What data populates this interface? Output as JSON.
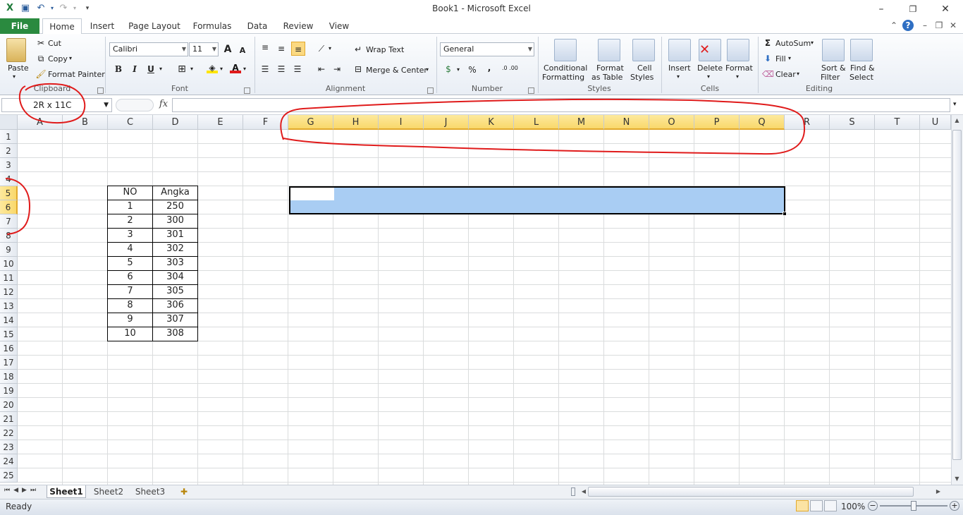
{
  "window": {
    "title": "Book1  -  Microsoft Excel"
  },
  "ribbon_tabs": [
    {
      "label": "File"
    },
    {
      "label": "Home"
    },
    {
      "label": "Insert"
    },
    {
      "label": "Page Layout"
    },
    {
      "label": "Formulas"
    },
    {
      "label": "Data"
    },
    {
      "label": "Review"
    },
    {
      "label": "View"
    }
  ],
  "clipboard": {
    "paste": "Paste",
    "cut": "Cut",
    "copy": "Copy",
    "format_painter": "Format Painter",
    "label": "Clipboard"
  },
  "font": {
    "name": "Calibri",
    "size": "11",
    "bold": "B",
    "italic": "I",
    "underline": "U",
    "label": "Font"
  },
  "alignment": {
    "wrap_text": "Wrap Text",
    "merge_center": "Merge & Center",
    "label": "Alignment"
  },
  "number": {
    "format": "General",
    "percent": "%",
    "comma": ",",
    "inc_decimal": ".0 .00",
    "label": "Number"
  },
  "styles": {
    "conditional": "Conditional",
    "conditional2": "Formatting",
    "format_table": "Format",
    "format_table2": "as Table",
    "cell_styles": "Cell",
    "cell_styles2": "Styles",
    "label": "Styles"
  },
  "cells": {
    "insert": "Insert",
    "delete": "Delete",
    "format": "Format",
    "label": "Cells"
  },
  "editing": {
    "autosum": "AutoSum",
    "fill": "Fill",
    "clear": "Clear",
    "sort": "Sort &",
    "sort2": "Filter",
    "find": "Find &",
    "find2": "Select",
    "label": "Editing"
  },
  "formula_bar": {
    "name_box": "2R x 11C",
    "fx": "fx",
    "value": ""
  },
  "columns": [
    "A",
    "B",
    "C",
    "D",
    "E",
    "F",
    "G",
    "H",
    "I",
    "J",
    "K",
    "L",
    "M",
    "N",
    "O",
    "P",
    "Q",
    "R",
    "S",
    "T",
    "U"
  ],
  "rows": [
    "1",
    "2",
    "3",
    "4",
    "5",
    "6",
    "7",
    "8",
    "9",
    "10",
    "11",
    "12",
    "13",
    "14",
    "15",
    "16",
    "17",
    "18",
    "19",
    "20",
    "21",
    "22",
    "23",
    "24",
    "25"
  ],
  "table": {
    "header": [
      "NO",
      "Angka"
    ],
    "rows": [
      [
        "1",
        "250"
      ],
      [
        "2",
        "300"
      ],
      [
        "3",
        "301"
      ],
      [
        "4",
        "302"
      ],
      [
        "5",
        "303"
      ],
      [
        "6",
        "304"
      ],
      [
        "7",
        "305"
      ],
      [
        "8",
        "306"
      ],
      [
        "9",
        "307"
      ],
      [
        "10",
        "308"
      ]
    ]
  },
  "sheets": [
    {
      "label": "Sheet1"
    },
    {
      "label": "Sheet2"
    },
    {
      "label": "Sheet3"
    }
  ],
  "status": {
    "text": "Ready",
    "zoom": "100%"
  },
  "colors": {
    "file_tab": "#2a8a3f",
    "selection": "#a9cdf3",
    "header_selected": "#f9d86b",
    "annotation": "#e01b1b"
  }
}
